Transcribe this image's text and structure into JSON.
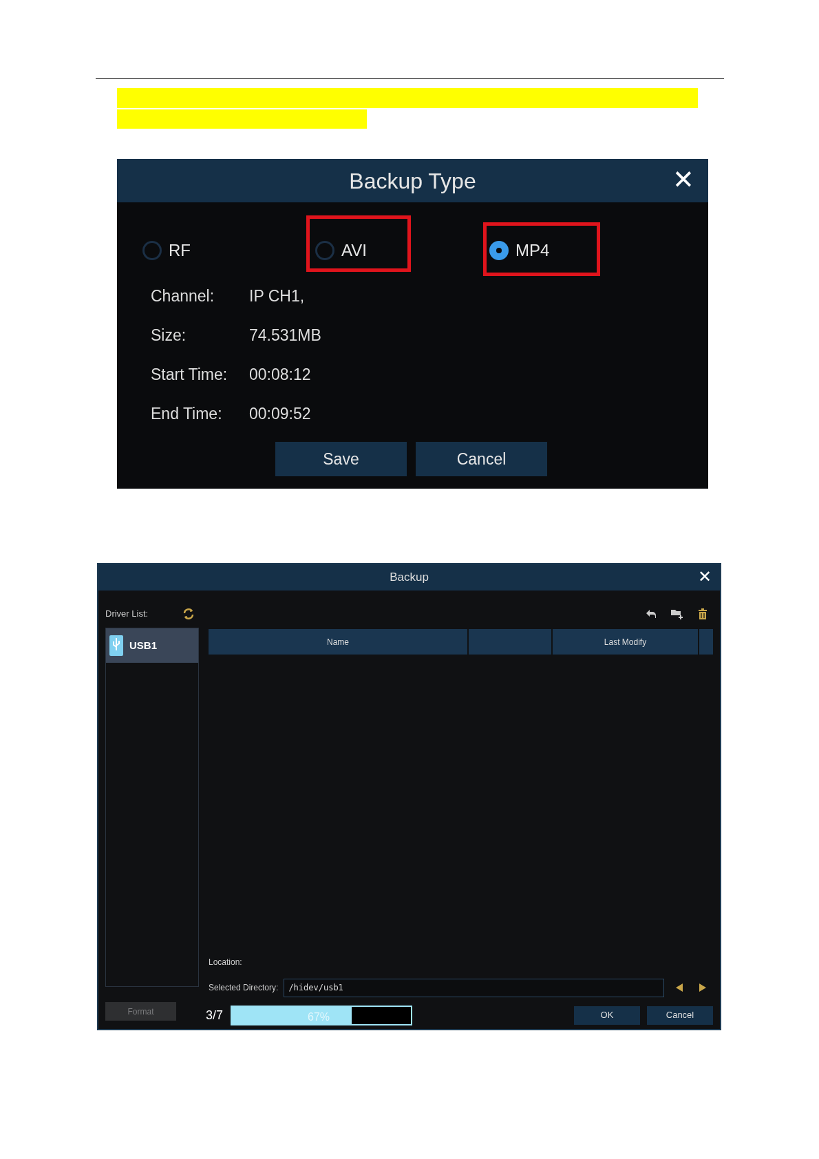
{
  "backup_type_dialog": {
    "title": "Backup Type",
    "close": "✕",
    "options": [
      {
        "label": "RF",
        "selected": false,
        "highlighted": false
      },
      {
        "label": "AVI",
        "selected": false,
        "highlighted": true
      },
      {
        "label": "MP4",
        "selected": true,
        "highlighted": true
      }
    ],
    "fields": [
      {
        "label": "Channel:",
        "value": "IP CH1,"
      },
      {
        "label": "Size:",
        "value": "74.531MB"
      },
      {
        "label": "Start Time:",
        "value": "00:08:12"
      },
      {
        "label": "End Time:",
        "value": "00:09:52"
      }
    ],
    "buttons": [
      "Save",
      "Cancel"
    ]
  },
  "backup_dialog": {
    "title": "Backup",
    "close": "✕",
    "driver_list_label": "Driver List:",
    "drivers": [
      {
        "label": "USB1",
        "selected": true
      }
    ],
    "table": {
      "columns": [
        "Name",
        "",
        "Last Modify",
        ""
      ]
    },
    "location_label": "Location:",
    "selected_directory_label": "Selected Directory:",
    "selected_directory": "/hidev/usb1",
    "format_button": {
      "label": "Format",
      "disabled": true
    },
    "progress": {
      "count": "3/7",
      "level": 0.67,
      "reading": "67%"
    },
    "buttons": [
      "OK",
      "Cancel"
    ]
  }
}
